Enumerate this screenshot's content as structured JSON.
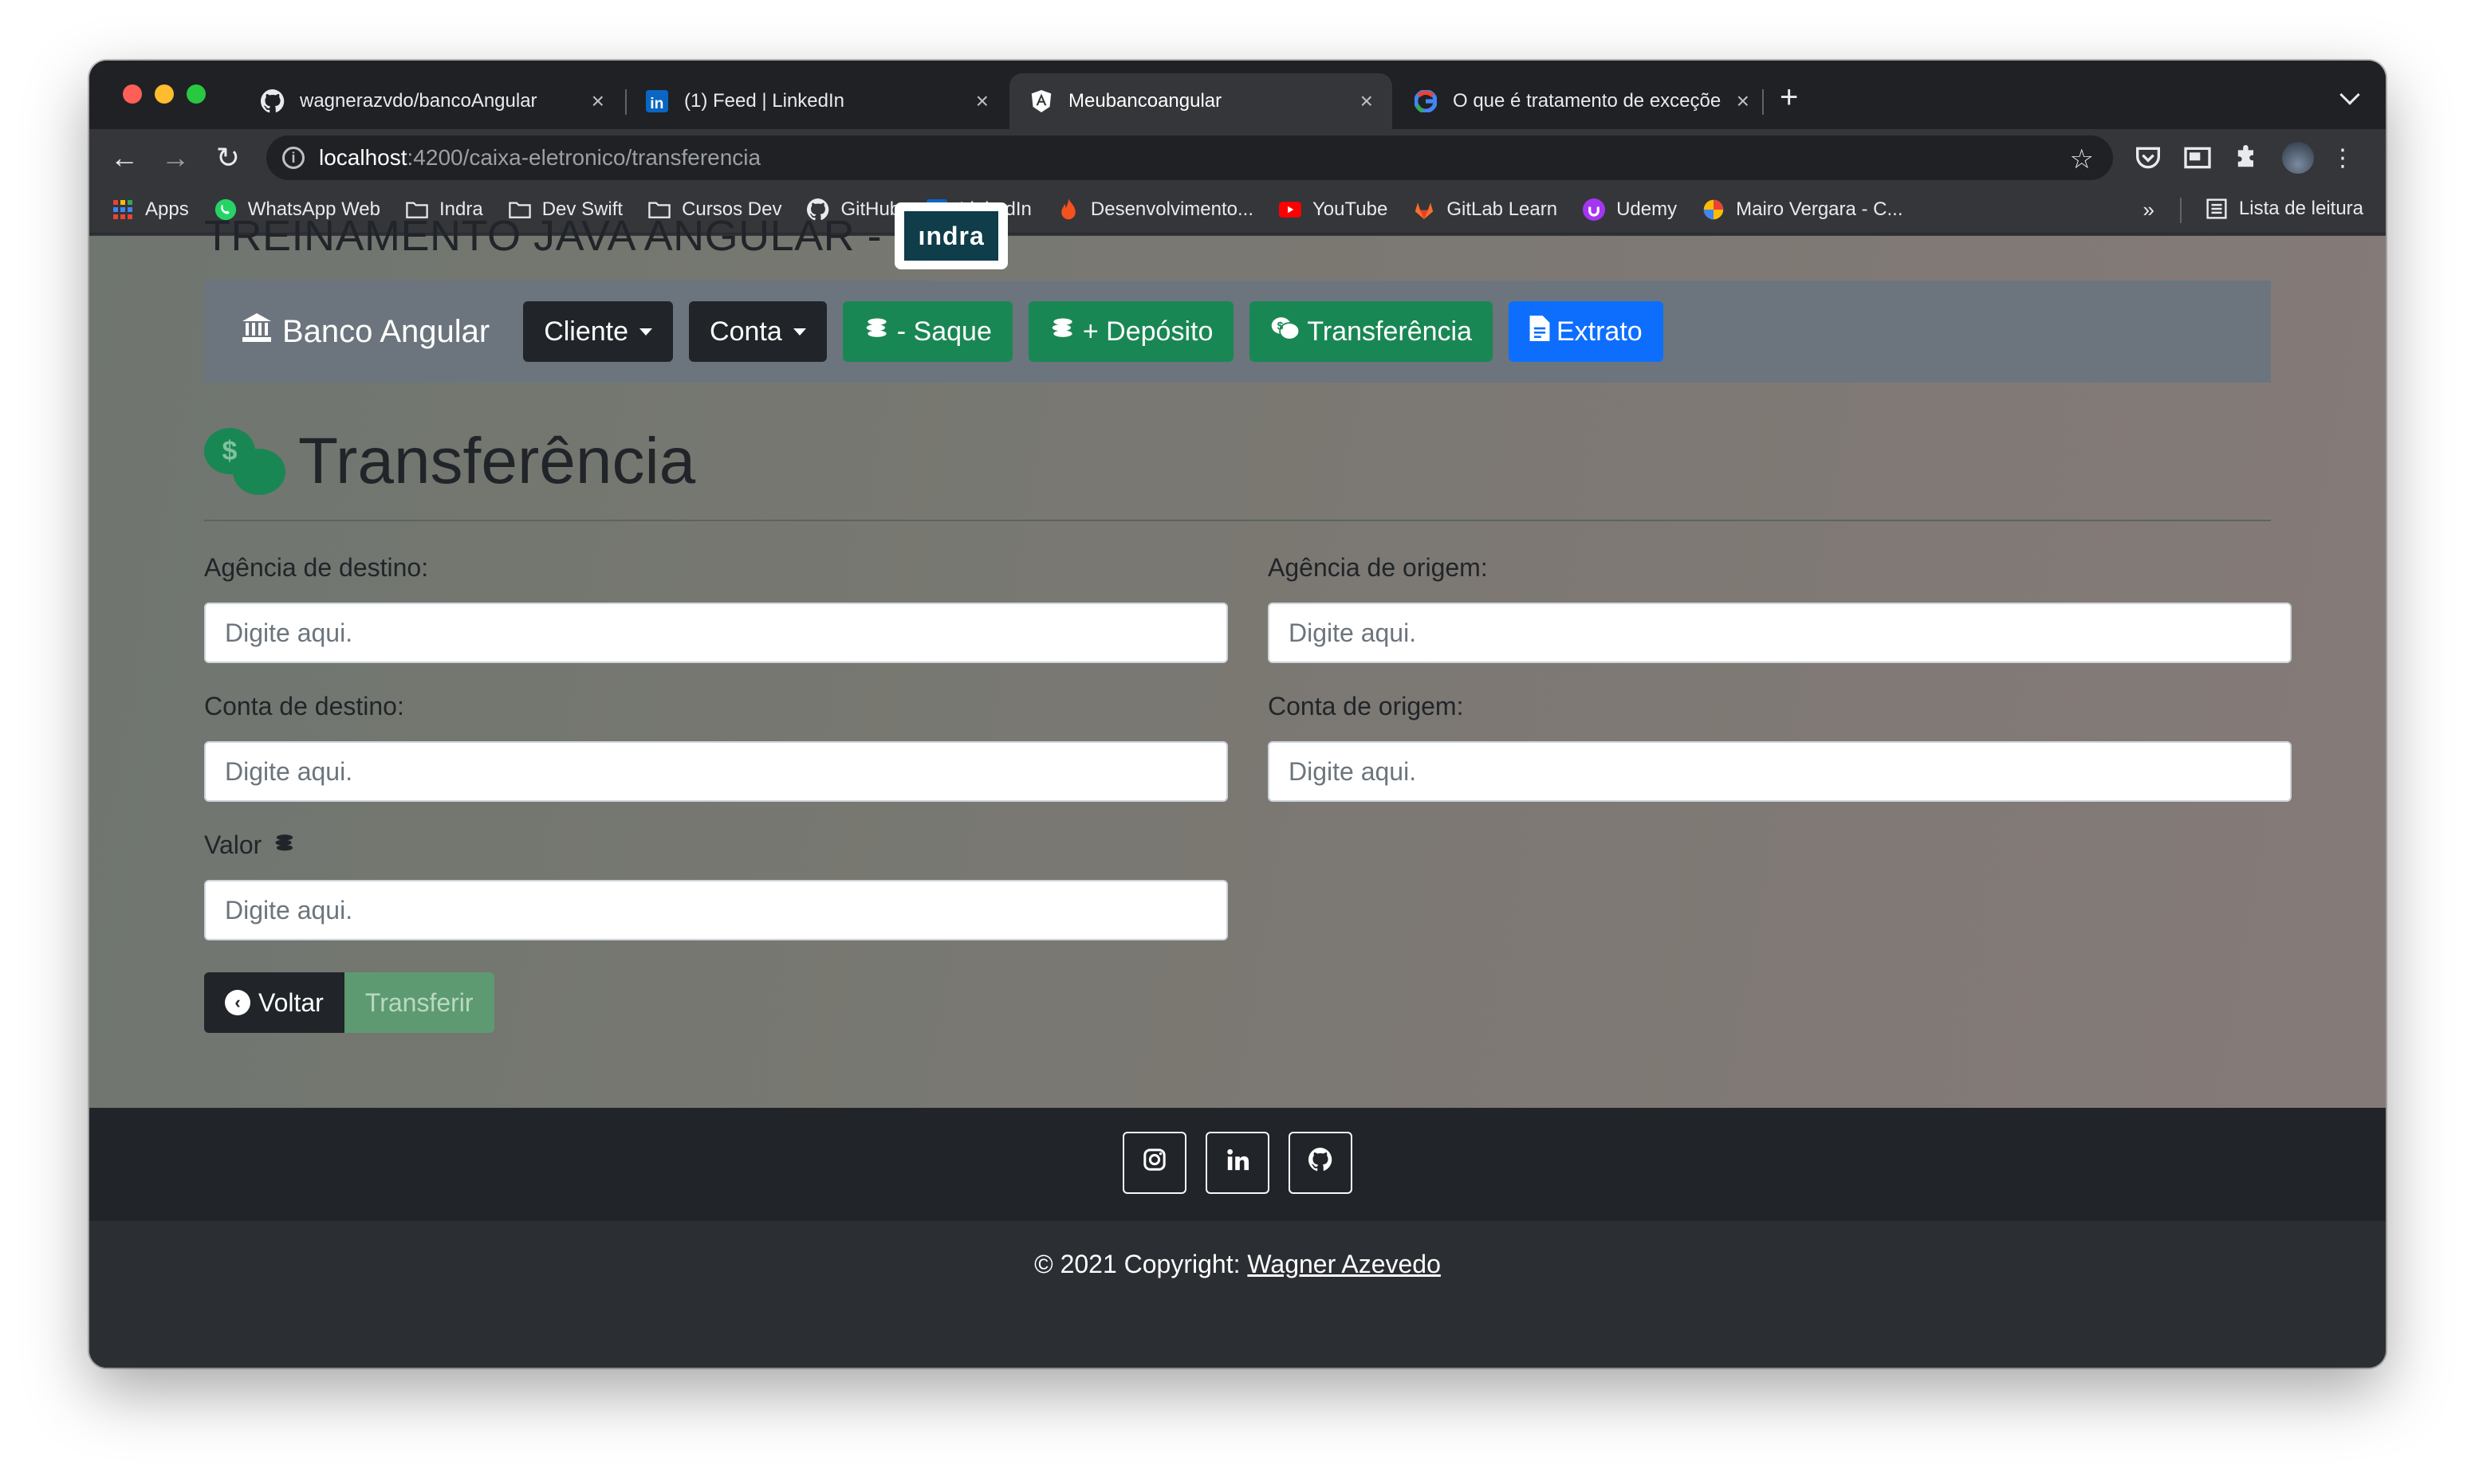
{
  "browser": {
    "tabs": [
      {
        "title": "wagnerazvdo/bancoAngular",
        "icon": "github-icon"
      },
      {
        "title": "(1) Feed | LinkedIn",
        "icon": "linkedin-icon"
      },
      {
        "title": "Meubancoangular",
        "icon": "angular-icon",
        "active": true
      },
      {
        "title": "O que é tratamento de exceçõe",
        "icon": "google-icon"
      }
    ],
    "url_host": "localhost",
    "url_path": ":4200/caixa-eletronico/transferencia",
    "bookmarks": [
      {
        "label": "Apps",
        "icon": "apps-grid-icon"
      },
      {
        "label": "WhatsApp Web",
        "icon": "whatsapp-icon"
      },
      {
        "label": "Indra",
        "icon": "folder-icon"
      },
      {
        "label": "Dev Swift",
        "icon": "folder-icon"
      },
      {
        "label": "Cursos Dev",
        "icon": "folder-icon"
      },
      {
        "label": "GitHub",
        "icon": "github-icon"
      },
      {
        "label": "LinkedIn",
        "icon": "linkedin-icon"
      },
      {
        "label": "Desenvolvimento...",
        "icon": "flame-icon"
      },
      {
        "label": "YouTube",
        "icon": "youtube-icon"
      },
      {
        "label": "GitLab Learn",
        "icon": "gitlab-icon"
      },
      {
        "label": "Udemy",
        "icon": "udemy-icon"
      },
      {
        "label": "Mairo Vergara - C...",
        "icon": "colorful-circle-icon"
      }
    ],
    "bookmarks_more": "»",
    "reading_list": "Lista de leitura"
  },
  "header": {
    "title": "TREINAMENTO JAVA ANGULAR -",
    "logo_text": "ındra"
  },
  "navbar": {
    "brand": "Banco Angular",
    "cliente": "Cliente",
    "conta": "Conta",
    "saque": "- Saque",
    "deposito": "+ Depósito",
    "transferencia": "Transferência",
    "extrato": "Extrato"
  },
  "form": {
    "title": "Transferência",
    "agencia_destino_label": "Agência de destino:",
    "agencia_origem_label": "Agência de origem:",
    "conta_destino_label": "Conta de destino:",
    "conta_origem_label": "Conta de origem:",
    "valor_label": "Valor",
    "placeholder": "Digite aqui.",
    "voltar": "Voltar",
    "transferir": "Transferir"
  },
  "footer": {
    "copyright_prefix": "© 2021 Copyright:",
    "author": "Wagner Azevedo"
  },
  "colors": {
    "success": "#198754",
    "primary": "#0d6efd",
    "dark": "#212529",
    "navbar_gray": "#6c757d"
  }
}
